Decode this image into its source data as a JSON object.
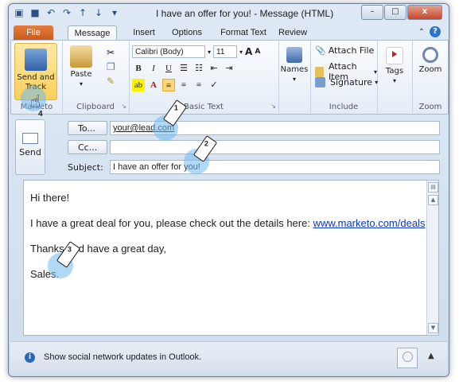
{
  "window": {
    "title": "I have an offer for you!  -  Message (HTML)",
    "controls": {
      "minimize": "–",
      "maximize": "□",
      "close": "x"
    }
  },
  "qat": [
    "save-icon",
    "undo-icon",
    "redo-icon",
    "up-icon",
    "down-icon"
  ],
  "tabs": {
    "file": "File",
    "items": [
      "Message",
      "Insert",
      "Options",
      "Format Text",
      "Review"
    ],
    "active": "Message",
    "help": "?"
  },
  "ribbon": {
    "groups": {
      "marketo": "Marketo",
      "clipboard": "Clipboard",
      "basic_text": "Basic Text",
      "include": "Include",
      "zoom": "Zoom"
    },
    "send_and_track": "Send and Track",
    "paste": "Paste",
    "font_name": "Calibri (Body)",
    "font_size": "11",
    "bold": "B",
    "italic": "I",
    "underline": "U",
    "names": "Names",
    "attach_file": "Attach File",
    "attach_item": "Attach Item",
    "signature": "Signature",
    "tags": "Tags",
    "zoom": "Zoom"
  },
  "header": {
    "send_label": "Send",
    "to_button": "To...",
    "cc_button": "Cc...",
    "subject_label": "Subject:",
    "to_value": "your@lead.com",
    "cc_value": "",
    "subject_value": "I have an offer for you!"
  },
  "body": {
    "greeting": "Hi there!",
    "line1_text": "I have a great deal for you, please check out the details here: ",
    "line1_link": "www.marketo.com/deals",
    "closing": "Thanks and have a great day,",
    "signature": "Sales."
  },
  "statusbar": {
    "info_icon": "i",
    "text": "Show social network updates in Outlook.",
    "expand": "▲"
  },
  "callouts": [
    "1",
    "2",
    "3",
    "4"
  ]
}
